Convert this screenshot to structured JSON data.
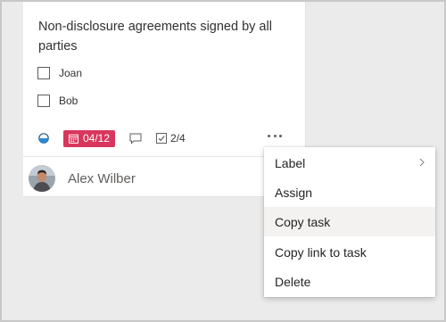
{
  "task": {
    "title": "Non-disclosure agreements signed by all parties",
    "checklist": [
      {
        "label": "Joan",
        "checked": false
      },
      {
        "label": "Bob",
        "checked": false
      }
    ],
    "progress_icon": "half-filled-circle-icon",
    "due_date": "04/12",
    "due_color": "#d8365d",
    "checklist_count": "2/4",
    "assignee": {
      "name": "Alex Wilber"
    }
  },
  "context_menu": {
    "items": [
      {
        "label": "Label",
        "has_submenu": true
      },
      {
        "label": "Assign"
      },
      {
        "label": "Copy task",
        "hovered": true
      },
      {
        "label": "Copy link to task"
      },
      {
        "label": "Delete"
      }
    ]
  }
}
